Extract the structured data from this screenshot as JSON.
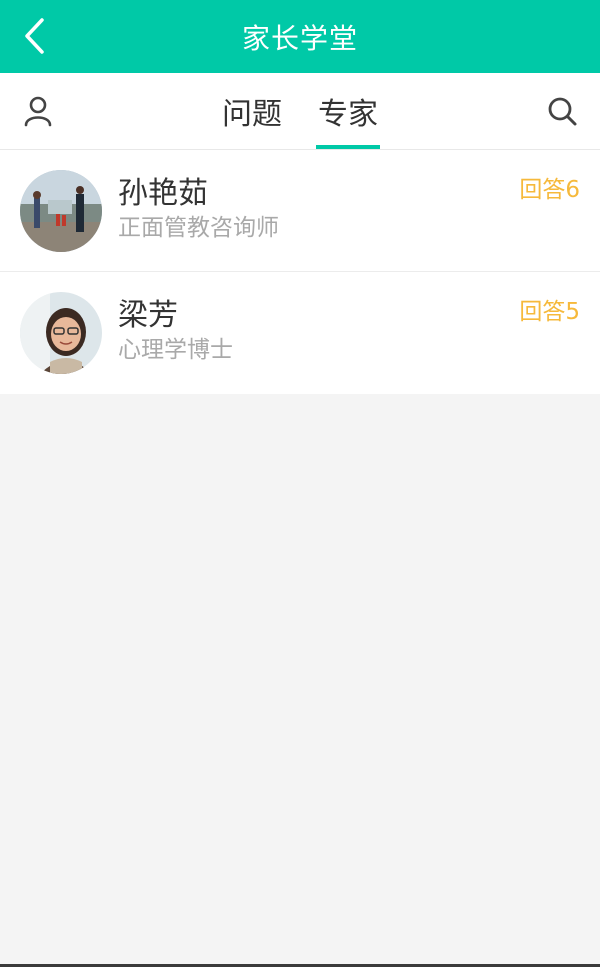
{
  "header": {
    "title": "家长学堂",
    "back_icon": "chevron-left-icon",
    "background": "#00c9a7"
  },
  "tabs": {
    "items": [
      {
        "label": "问题"
      },
      {
        "label": "专家"
      }
    ],
    "active": "专家",
    "user_icon": "user-icon",
    "search_icon": "search-icon",
    "accent": "#00c9a7"
  },
  "experts": [
    {
      "name": "孙艳茹",
      "title": "正面管教咨询师",
      "answers": "回答6"
    },
    {
      "name": "梁芳",
      "title": "心理学博士",
      "answers": "回答5"
    }
  ],
  "colors": {
    "answers_text": "#f6b93b",
    "subtitle_text": "#a9a9a9",
    "page_background": "#f4f4f4"
  }
}
